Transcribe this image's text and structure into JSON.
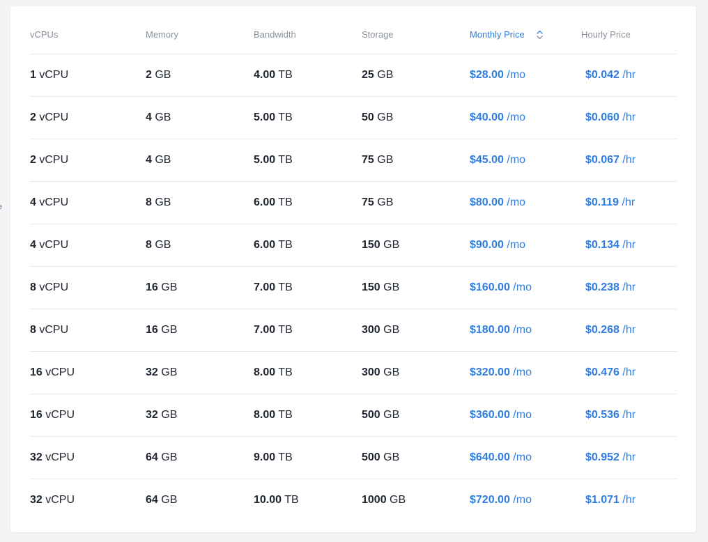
{
  "edge_glyph": "e",
  "table": {
    "headers": {
      "vcpus": "vCPUs",
      "memory": "Memory",
      "bandwidth": "Bandwidth",
      "storage": "Storage",
      "monthly": "Monthly Price",
      "hourly": "Hourly Price"
    },
    "sort": {
      "column": "monthly",
      "icon": "sort-updown-icon"
    },
    "accent_color": "#2f7de1",
    "rows": [
      {
        "vcpu": "1",
        "vcpu_unit": "vCPU",
        "mem": "2",
        "mem_unit": "GB",
        "bw": "4.00",
        "bw_unit": "TB",
        "storage": "25",
        "storage_unit": "GB",
        "monthly": "$28.00",
        "monthly_unit": "/mo",
        "hourly": "$0.042",
        "hourly_unit": "/hr"
      },
      {
        "vcpu": "2",
        "vcpu_unit": "vCPU",
        "mem": "4",
        "mem_unit": "GB",
        "bw": "5.00",
        "bw_unit": "TB",
        "storage": "50",
        "storage_unit": "GB",
        "monthly": "$40.00",
        "monthly_unit": "/mo",
        "hourly": "$0.060",
        "hourly_unit": "/hr"
      },
      {
        "vcpu": "2",
        "vcpu_unit": "vCPU",
        "mem": "4",
        "mem_unit": "GB",
        "bw": "5.00",
        "bw_unit": "TB",
        "storage": "75",
        "storage_unit": "GB",
        "monthly": "$45.00",
        "monthly_unit": "/mo",
        "hourly": "$0.067",
        "hourly_unit": "/hr"
      },
      {
        "vcpu": "4",
        "vcpu_unit": "vCPU",
        "mem": "8",
        "mem_unit": "GB",
        "bw": "6.00",
        "bw_unit": "TB",
        "storage": "75",
        "storage_unit": "GB",
        "monthly": "$80.00",
        "monthly_unit": "/mo",
        "hourly": "$0.119",
        "hourly_unit": "/hr"
      },
      {
        "vcpu": "4",
        "vcpu_unit": "vCPU",
        "mem": "8",
        "mem_unit": "GB",
        "bw": "6.00",
        "bw_unit": "TB",
        "storage": "150",
        "storage_unit": "GB",
        "monthly": "$90.00",
        "monthly_unit": "/mo",
        "hourly": "$0.134",
        "hourly_unit": "/hr"
      },
      {
        "vcpu": "8",
        "vcpu_unit": "vCPU",
        "mem": "16",
        "mem_unit": "GB",
        "bw": "7.00",
        "bw_unit": "TB",
        "storage": "150",
        "storage_unit": "GB",
        "monthly": "$160.00",
        "monthly_unit": "/mo",
        "hourly": "$0.238",
        "hourly_unit": "/hr"
      },
      {
        "vcpu": "8",
        "vcpu_unit": "vCPU",
        "mem": "16",
        "mem_unit": "GB",
        "bw": "7.00",
        "bw_unit": "TB",
        "storage": "300",
        "storage_unit": "GB",
        "monthly": "$180.00",
        "monthly_unit": "/mo",
        "hourly": "$0.268",
        "hourly_unit": "/hr"
      },
      {
        "vcpu": "16",
        "vcpu_unit": "vCPU",
        "mem": "32",
        "mem_unit": "GB",
        "bw": "8.00",
        "bw_unit": "TB",
        "storage": "300",
        "storage_unit": "GB",
        "monthly": "$320.00",
        "monthly_unit": "/mo",
        "hourly": "$0.476",
        "hourly_unit": "/hr"
      },
      {
        "vcpu": "16",
        "vcpu_unit": "vCPU",
        "mem": "32",
        "mem_unit": "GB",
        "bw": "8.00",
        "bw_unit": "TB",
        "storage": "500",
        "storage_unit": "GB",
        "monthly": "$360.00",
        "monthly_unit": "/mo",
        "hourly": "$0.536",
        "hourly_unit": "/hr"
      },
      {
        "vcpu": "32",
        "vcpu_unit": "vCPU",
        "mem": "64",
        "mem_unit": "GB",
        "bw": "9.00",
        "bw_unit": "TB",
        "storage": "500",
        "storage_unit": "GB",
        "monthly": "$640.00",
        "monthly_unit": "/mo",
        "hourly": "$0.952",
        "hourly_unit": "/hr"
      },
      {
        "vcpu": "32",
        "vcpu_unit": "vCPU",
        "mem": "64",
        "mem_unit": "GB",
        "bw": "10.00",
        "bw_unit": "TB",
        "storage": "1000",
        "storage_unit": "GB",
        "monthly": "$720.00",
        "monthly_unit": "/mo",
        "hourly": "$1.071",
        "hourly_unit": "/hr"
      }
    ]
  }
}
